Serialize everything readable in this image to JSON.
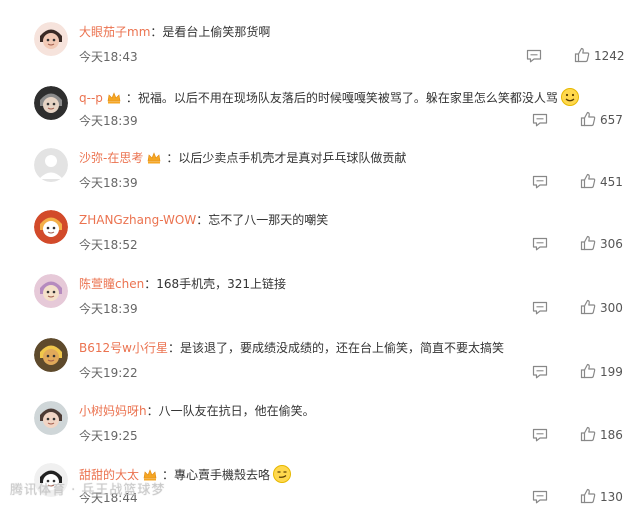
{
  "comments": [
    {
      "user": "大眼茄子mm",
      "crown": false,
      "text": "是看台上偷笑那货啊",
      "time": "今天18:43",
      "likes": "1242",
      "emoji": ""
    },
    {
      "user": "q--p",
      "crown": true,
      "text": "祝福。以后不用在现场队友落后的时候嘎嘎笑被骂了。躲在家里怎么笑都没人骂",
      "time": "今天18:39",
      "likes": "657",
      "emoji": "smile"
    },
    {
      "user": "沙弥-在思考",
      "crown": true,
      "text": "以后少卖点手机壳才是真对乒乓球队做贡献",
      "time": "今天18:39",
      "likes": "451",
      "emoji": ""
    },
    {
      "user": "ZHANGzhang-WOW",
      "crown": false,
      "text": "忘不了八一那天的嘲笑",
      "time": "今天18:52",
      "likes": "306",
      "emoji": ""
    },
    {
      "user": "陈萱瞳chen",
      "crown": false,
      "text": "168手机壳，321上链接",
      "time": "今天18:39",
      "likes": "300",
      "emoji": ""
    },
    {
      "user": "B612号w小行星",
      "crown": false,
      "text": "是该退了，要成绩没成绩的，还在台上偷笑，简直不要太搞笑",
      "time": "今天19:22",
      "likes": "199",
      "emoji": ""
    },
    {
      "user": "小树妈妈呀h",
      "crown": false,
      "text": "八一队友在抗日，他在偷笑。",
      "time": "今天19:25",
      "likes": "186",
      "emoji": ""
    },
    {
      "user": "甜甜的大太",
      "crown": true,
      "text": "專心賣手機殼去咯",
      "time": "今天18:44",
      "likes": "130",
      "emoji": "smirk"
    }
  ],
  "watermark": "腾讯体育 · 兵王战篮球梦",
  "colors": {
    "username": "#eb7350",
    "crown": "#f5a623",
    "time": "#666666"
  },
  "icons": {
    "reply": "comment-reply-icon",
    "like": "thumbs-up-icon",
    "crown": "crown-badge-icon"
  }
}
